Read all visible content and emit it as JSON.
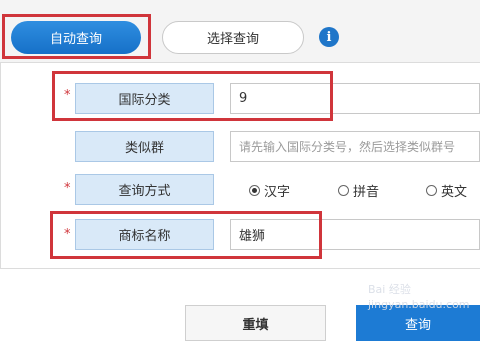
{
  "tabs": {
    "auto_query": "自动查询",
    "select_query": "选择查询"
  },
  "info_icon_glyph": "i",
  "form": {
    "required_mark": "*",
    "intl_class": {
      "label": "国际分类",
      "value": "9"
    },
    "similar_group": {
      "label": "类似群",
      "placeholder": "请先输入国际分类号，然后选择类似群号"
    },
    "query_method": {
      "label": "查询方式",
      "options": [
        "汉字",
        "拼音",
        "英文"
      ],
      "selected": "汉字"
    },
    "trademark_name": {
      "label": "商标名称",
      "value": "雄狮"
    }
  },
  "buttons": {
    "reset": "重填",
    "query": "查询"
  },
  "watermark": {
    "line1": "Bai 经验",
    "line2": "jingyan.baidu.com"
  },
  "colors": {
    "accent_blue": "#1d7bd4",
    "label_bg": "#d9e9f8",
    "highlight_red": "#d0353b"
  }
}
